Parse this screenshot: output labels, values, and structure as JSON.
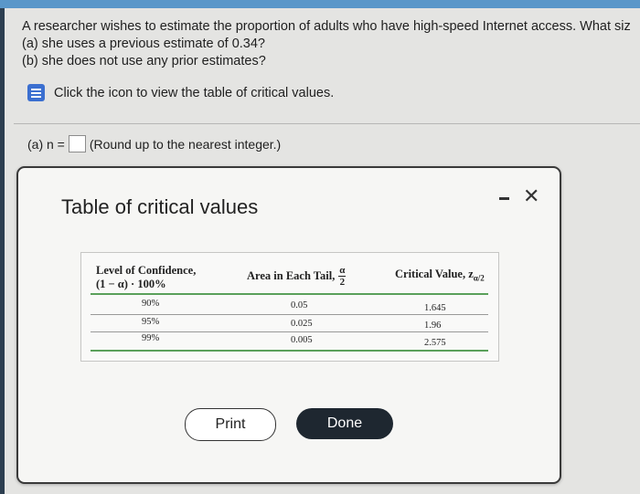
{
  "question": {
    "line1": "A researcher wishes to estimate the proportion of adults who have high-speed Internet access. What siz",
    "line2": "(a) she uses a previous estimate of 0.34?",
    "line3": "(b) she does not use any prior estimates?"
  },
  "hint": {
    "text": "Click the icon to view the table of critical values.",
    "icon": "table-icon"
  },
  "answer": {
    "prefix": "(a) n =",
    "value": "",
    "suffix": "(Round up to the nearest integer.)"
  },
  "modal": {
    "title": "Table of critical values",
    "minimize_icon": "minimize-icon",
    "close_symbol": "✕",
    "headers": {
      "confidence_line1": "Level of Confidence,",
      "confidence_line2": "(1 − α) · 100%",
      "tail_text": "Area in Each Tail,",
      "tail_numerator": "α",
      "tail_denominator": "2",
      "critical_text": "Critical Value, z",
      "critical_sub": "α/2"
    },
    "rows": [
      {
        "confidence": "90%",
        "tail": "0.05",
        "critical": "1.645"
      },
      {
        "confidence": "95%",
        "tail": "0.025",
        "critical": "1.96"
      },
      {
        "confidence": "99%",
        "tail": "0.005",
        "critical": "2.575"
      }
    ],
    "print_label": "Print",
    "done_label": "Done"
  },
  "colors": {
    "accent": "#5a97c9",
    "done_button": "#1e2730",
    "table_rule_green": "#5aa05a",
    "icon_blue": "#3b6fd0"
  }
}
